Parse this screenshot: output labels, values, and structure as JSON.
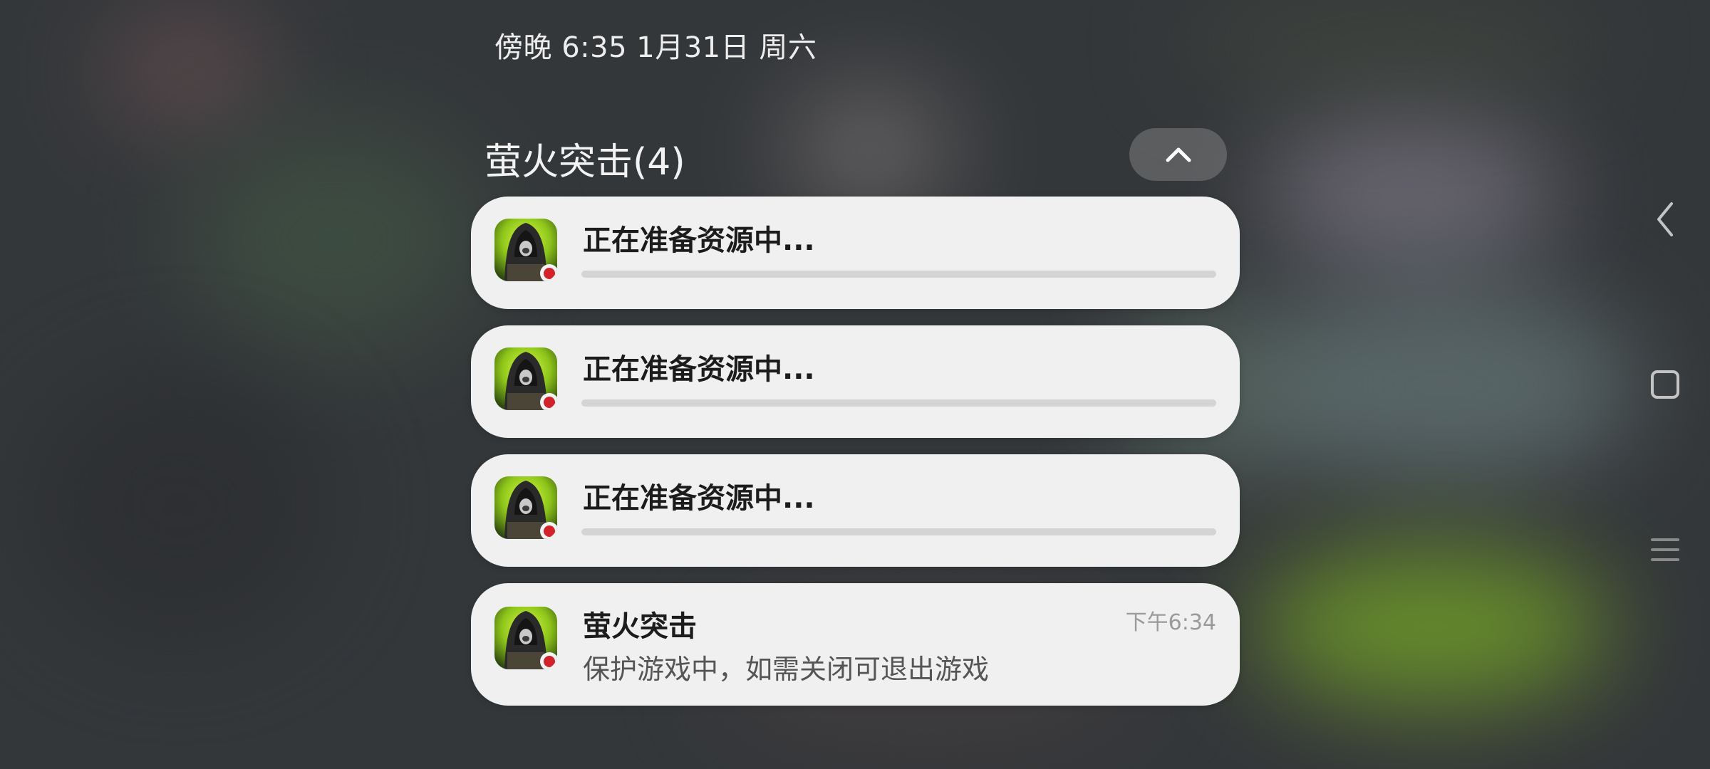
{
  "status_bar": {
    "time_date": "傍晚 6:35  1月31日 周六"
  },
  "group": {
    "title": "萤火突击(4)",
    "collapse_icon": "chevron-up-icon"
  },
  "notifications": [
    {
      "app_icon": "firefly-assault-app-icon",
      "title": "正在准备资源中...",
      "progress": 0.0
    },
    {
      "app_icon": "firefly-assault-app-icon",
      "title": "正在准备资源中...",
      "progress": 0.0
    },
    {
      "app_icon": "firefly-assault-app-icon",
      "title": "正在准备资源中...",
      "progress": 0.0
    },
    {
      "app_icon": "firefly-assault-app-icon",
      "title": "萤火突击",
      "time": "下午6:34",
      "body": "保护游戏中，如需关闭可退出游戏"
    }
  ],
  "navigation": {
    "back_icon": "back-chevron-icon",
    "home_icon": "home-square-icon",
    "menu_icon": "menu-lines-icon"
  },
  "colors": {
    "card_bg": "#f0f0f0",
    "accent_green": "#9fe01a",
    "badge_red": "#d2232a"
  }
}
